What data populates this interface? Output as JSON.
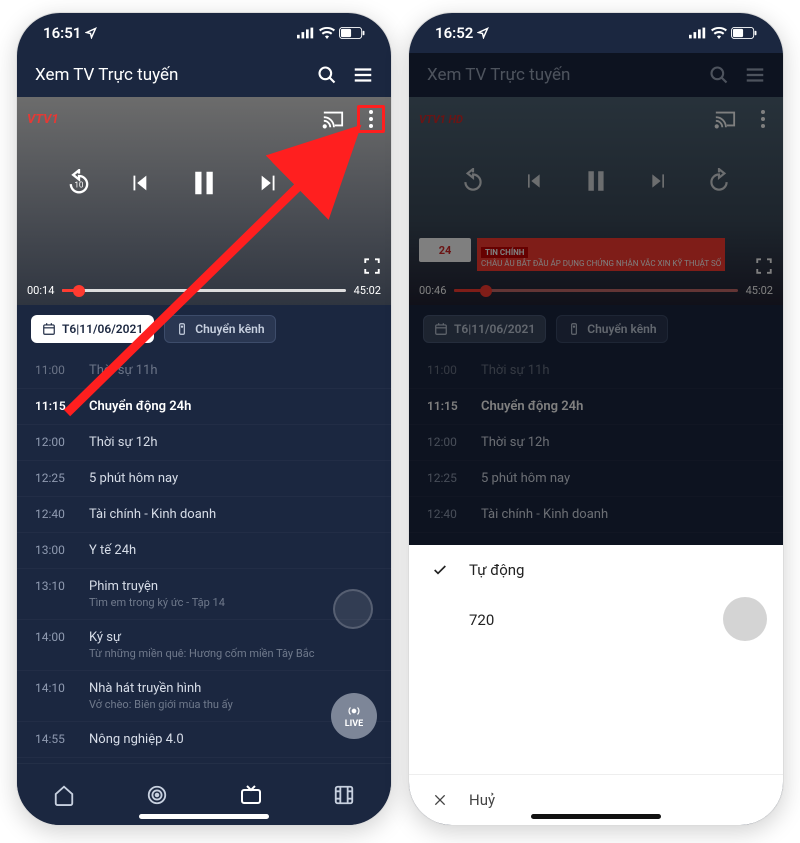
{
  "colors": {
    "accent": "#ff3b30",
    "bg": "#1b2740"
  },
  "phone1": {
    "status": {
      "time": "16:51"
    },
    "header": {
      "title": "Xem TV Trực tuyến"
    },
    "player": {
      "channel": "VTV1",
      "current": "00:14",
      "duration": "45:02",
      "progress_pct": 6
    },
    "toolbar": {
      "date_label": "T6|11/06/2021",
      "switch_label": "Chuyển kênh"
    },
    "schedule": [
      {
        "time": "11:00",
        "title": "Thời sự 11h",
        "first": true
      },
      {
        "time": "11:15",
        "title": "Chuyển động 24h",
        "active": true
      },
      {
        "time": "12:00",
        "title": "Thời sự 12h"
      },
      {
        "time": "12:25",
        "title": "5 phút hôm nay"
      },
      {
        "time": "12:40",
        "title": "Tài chính - Kinh doanh"
      },
      {
        "time": "13:00",
        "title": "Y tế 24h"
      },
      {
        "time": "13:10",
        "title": "Phim truyện",
        "sub": "Tìm em trong ký ức - Tập 14"
      },
      {
        "time": "14:00",
        "title": "Ký sự",
        "sub": "Từ những miền quê: Hương cốm miền Tây Bắc"
      },
      {
        "time": "14:10",
        "title": "Nhà hát truyền hình",
        "sub": "Vở chèo: Biên giới mùa thu ấy"
      },
      {
        "time": "14:55",
        "title": "Nông nghiệp 4.0"
      }
    ],
    "live_badge": "LIVE"
  },
  "phone2": {
    "status": {
      "time": "16:52"
    },
    "header": {
      "title": "Xem TV Trực tuyến"
    },
    "player": {
      "channel": "VTV1 HD",
      "current": "00:46",
      "duration": "45:02",
      "progress_pct": 11,
      "ticker_tag": "TIN CHÍNH",
      "ticker_badge": "24",
      "headline": "CHÂU ÂU BẮT ĐẦU ÁP DỤNG CHỨNG NHẬN VẮC XIN KỸ THUẬT SỐ"
    },
    "toolbar": {
      "date_label": "T6|11/06/2021",
      "switch_label": "Chuyển kênh"
    },
    "schedule": [
      {
        "time": "11:00",
        "title": "Thời sự 11h",
        "first": true
      },
      {
        "time": "11:15",
        "title": "Chuyển động 24h",
        "active": true
      },
      {
        "time": "12:00",
        "title": "Thời sự 12h"
      },
      {
        "time": "12:25",
        "title": "5 phút hôm nay"
      },
      {
        "time": "12:40",
        "title": "Tài chính - Kinh doanh"
      }
    ],
    "sheet": {
      "options": [
        {
          "label": "Tự động",
          "selected": true
        },
        {
          "label": "720",
          "selected": false
        }
      ],
      "cancel": "Huỷ"
    }
  }
}
